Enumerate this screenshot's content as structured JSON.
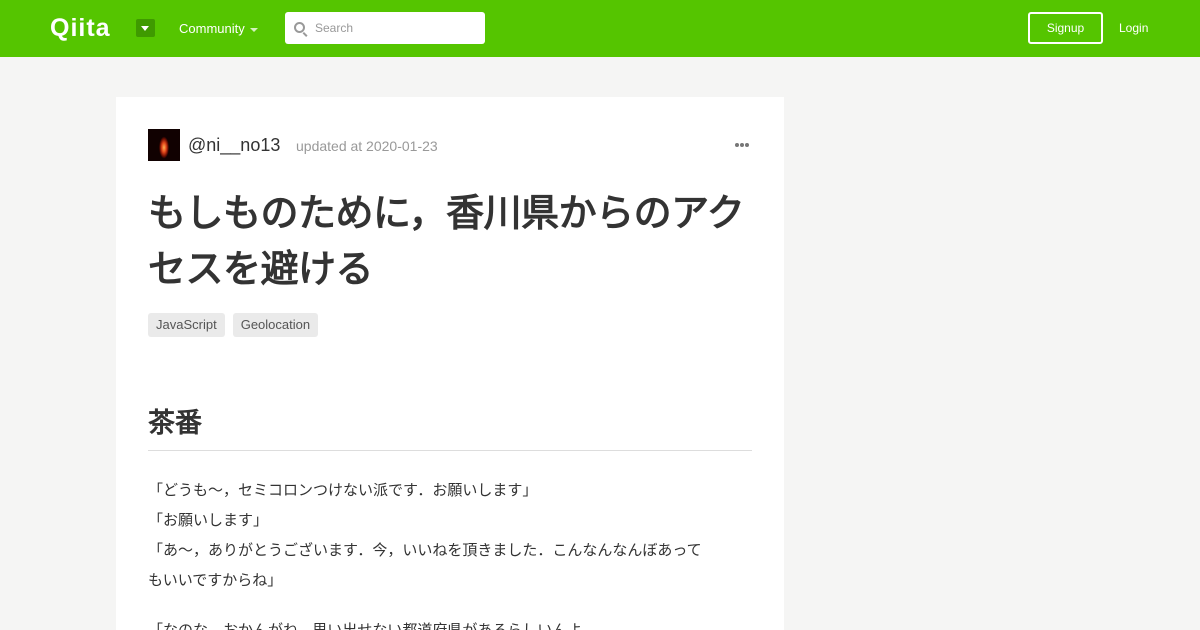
{
  "header": {
    "logo": "Qiita",
    "community_label": "Community",
    "search_placeholder": "Search",
    "signup_label": "Signup",
    "login_label": "Login",
    "brand_color": "#55c500"
  },
  "article": {
    "author": "@ni__no13",
    "updated": "updated at 2020-01-23",
    "title": "もしものために，香川県からのアクセスを避ける",
    "tags": [
      "JavaScript",
      "Geolocation"
    ],
    "section_heading": "茶番",
    "paragraph_lines": [
      "「どうも〜，セミコロンつけない派です．お願いします」",
      "「お願いします」",
      "「あ〜，ありがとうございます．今，いいねを頂きました．こんなんなんぼあって",
      "もいいですからね」"
    ],
    "next_paragraph_partial": "「なのな，おかんがね，思い出せない都道府県があるらしいんよ"
  }
}
